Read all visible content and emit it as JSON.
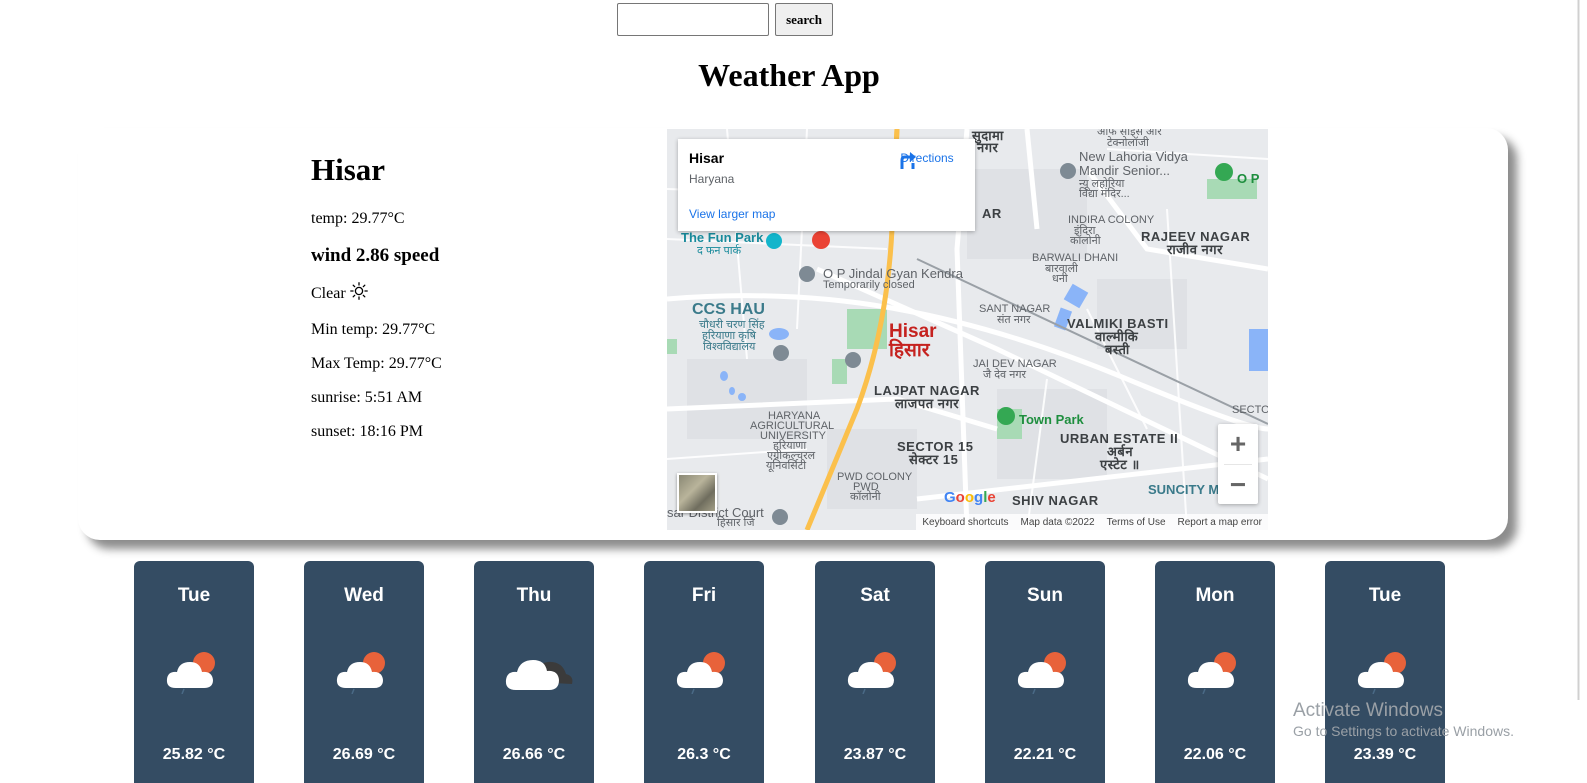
{
  "search": {
    "value": "",
    "placeholder": "",
    "button_label": "search"
  },
  "app": {
    "title": "Weather App"
  },
  "current": {
    "city": "Hisar",
    "temp": "temp: 29.77°C",
    "wind": "wind 2.86 speed",
    "condition": "Clear",
    "condition_icon": "sun-icon",
    "min_temp": "Min temp: 29.77°C",
    "max_temp": "Max Temp: 29.77°C",
    "sunrise": "sunrise: 5:51 AM",
    "sunset": "sunset: 18:16 PM"
  },
  "map": {
    "popup": {
      "title": "Hisar",
      "subtitle": "Haryana",
      "directions": "Directions",
      "larger_map": "View larger map"
    },
    "labels": {
      "sudama": "सुदामा",
      "nagar_top": "नगर",
      "new_lahoria": "New Lahoria Vidya",
      "mandir_senior": "Mandir Senior...",
      "new_lahoria_hi1": "न्यू लहोरिया",
      "new_lahoria_hi2": "विद्या मंदिर...",
      "op": "O P",
      "indira": "INDIRA COLONY",
      "indira_hi1": "इंदिरा",
      "indira_hi2": "कॉलोनी",
      "rajeev": "RAJEEV NAGAR",
      "rajeev_hi": "राजीव नगर",
      "fun_park": "The Fun Park",
      "fun_park_hi": "द फन पार्क",
      "jindal": "O P Jindal Gyan Kendra",
      "jindal_status": "Temporarily closed",
      "barwali": "BARWALI DHANI",
      "barwali_hi1": "बारवाली",
      "barwali_hi2": "धनी",
      "ccs": "CCS HAU",
      "ccs_hi1": "चौधरी चरण सिंह",
      "ccs_hi2": "हरियाणा कृषि",
      "ccs_hi3": "विश्वविद्यालय",
      "sant": "SANT NAGAR",
      "sant_hi": "संत नगर",
      "valmiki": "VALMIKI BASTI",
      "valmiki_hi1": "वाल्मीकि",
      "valmiki_hi2": "बस्ती",
      "hisar": "Hisar",
      "hisar_hi": "हिसार",
      "jai_dev": "JAI DEV NAGAR",
      "jai_dev_hi": "जै देव नगर",
      "lajpat": "LAJPAT NAGAR",
      "lajpat_hi": "लाजपत नगर",
      "town_park": "Town Park",
      "haryana_agri1": "HARYANA",
      "haryana_agri2": "AGRICULTURAL",
      "haryana_agri3": "UNIVERSITY",
      "haryana_agri_hi1": "हरियाणा",
      "haryana_agri_hi2": "एग्रीकल्चरल",
      "haryana_agri_hi3": "यूनिवर्सिटी",
      "sector15": "SECTOR 15",
      "sector15_hi": "सेक्टर 15",
      "urban_estate": "URBAN ESTATE II",
      "urban_hi1": "अर्बन",
      "urban_hi2": "एस्टेट ॥",
      "pwd": "PWD COLONY",
      "pwd_hi1": "PWD",
      "pwd_hi2": "कॉलोनी",
      "shiv": "SHIV NAGAR",
      "suncity": "SUNCITY M",
      "district_court": "sar District Court",
      "district_court_hi": "हिसार जि",
      "secto": "SECTO",
      "ar": "AR",
      "top_hi1": "आफ साइस आर",
      "top_hi2": "टेक्नोलॉजी"
    },
    "logo": "Google",
    "footer": {
      "shortcuts": "Keyboard shortcuts",
      "map_data": "Map data ©2022",
      "terms": "Terms of Use",
      "report": "Report a map error"
    },
    "colors": {
      "park": "#a8dab5",
      "water": "#8ab4f8",
      "road_major": "#fbc04c",
      "road": "#ffffff"
    }
  },
  "forecast": [
    {
      "day": "Tue",
      "temp": "25.82 °C",
      "icon": "cloud-sun-rain-icon"
    },
    {
      "day": "Wed",
      "temp": "26.69 °C",
      "icon": "cloud-sun-rain-icon"
    },
    {
      "day": "Thu",
      "temp": "26.66 °C",
      "icon": "cloud-dark-icon"
    },
    {
      "day": "Fri",
      "temp": "26.3 °C",
      "icon": "cloud-sun-rain-icon"
    },
    {
      "day": "Sat",
      "temp": "23.87 °C",
      "icon": "cloud-sun-rain-icon"
    },
    {
      "day": "Sun",
      "temp": "22.21 °C",
      "icon": "cloud-sun-rain-icon"
    },
    {
      "day": "Mon",
      "temp": "22.06 °C",
      "icon": "cloud-sun-rain-icon"
    },
    {
      "day": "Tue",
      "temp": "23.39 °C",
      "icon": "cloud-sun-rain-icon"
    }
  ],
  "watermark": {
    "title": "Activate Windows",
    "subtitle": "Go to Settings to activate Windows."
  },
  "colors": {
    "forecast_card": "#344c63",
    "sun": "#e8623a"
  }
}
